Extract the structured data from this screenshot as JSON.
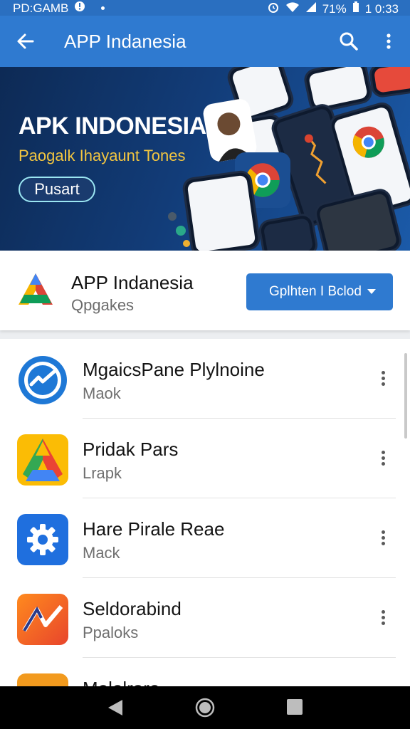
{
  "status_bar": {
    "carrier": "PD:GAMB",
    "battery": "71%",
    "time": "1 0:33"
  },
  "app_bar": {
    "title": "APP Indanesia",
    "back_icon": "back-arrow-icon",
    "search_icon": "search-icon",
    "more_icon": "more-vert-icon",
    "color": "#2f7ad0"
  },
  "banner": {
    "title": "APK INDONESIA",
    "subtitle": "Paogalk Ihayaunt Tones",
    "button_label": "Pusart"
  },
  "app_header": {
    "name": "APP Indanesia",
    "subtitle": "Qpgakes",
    "dropdown_label": "Gplhten I Bclod"
  },
  "apps": [
    {
      "title": "MgaicsPane Plylnoine",
      "subtitle": "Maok",
      "icon": "messenger-check-icon"
    },
    {
      "title": "Pridak Pars",
      "subtitle": "Lrapk",
      "icon": "google-drive-icon"
    },
    {
      "title": "Hare Pirale Reae",
      "subtitle": "Mack",
      "icon": "settings-gear-icon"
    },
    {
      "title": "Seldorabind",
      "subtitle": "Ppaloks",
      "icon": "analytics-arrow-icon"
    },
    {
      "title": "Melelrare",
      "subtitle": "",
      "icon": "circle-app-icon"
    }
  ]
}
